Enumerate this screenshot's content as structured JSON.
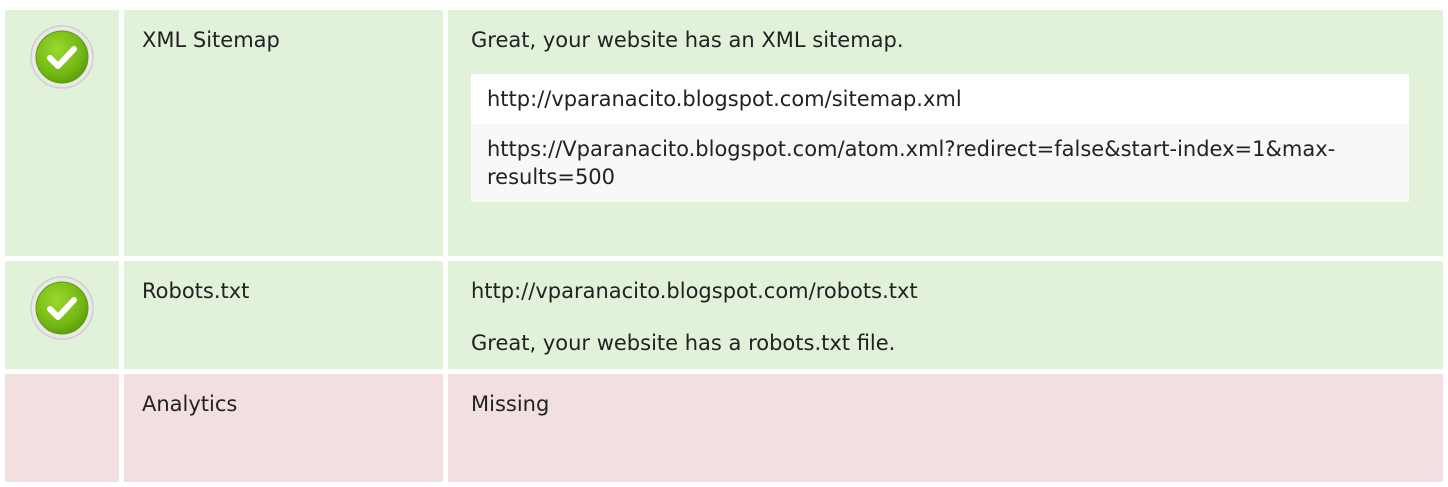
{
  "rows": [
    {
      "status": "pass",
      "name": "XML Sitemap",
      "message": "Great, your website has an XML sitemap.",
      "urls": [
        "http://vparanacito.blogspot.com/sitemap.xml",
        "https://Vparanacito.blogspot.com/atom.xml?redirect=false&start-index=1&max-results=500"
      ]
    },
    {
      "status": "pass",
      "name": "Robots.txt",
      "url": "http://vparanacito.blogspot.com/robots.txt",
      "message": "Great, your website has a robots.txt file."
    },
    {
      "status": "fail",
      "name": "Analytics",
      "message": "Missing"
    }
  ],
  "colors": {
    "pass_bg": "#e2f1da",
    "fail_bg": "#f2dfe0",
    "check_green": "#7cc11a"
  },
  "icons": {
    "pass": "check-circle-icon"
  }
}
